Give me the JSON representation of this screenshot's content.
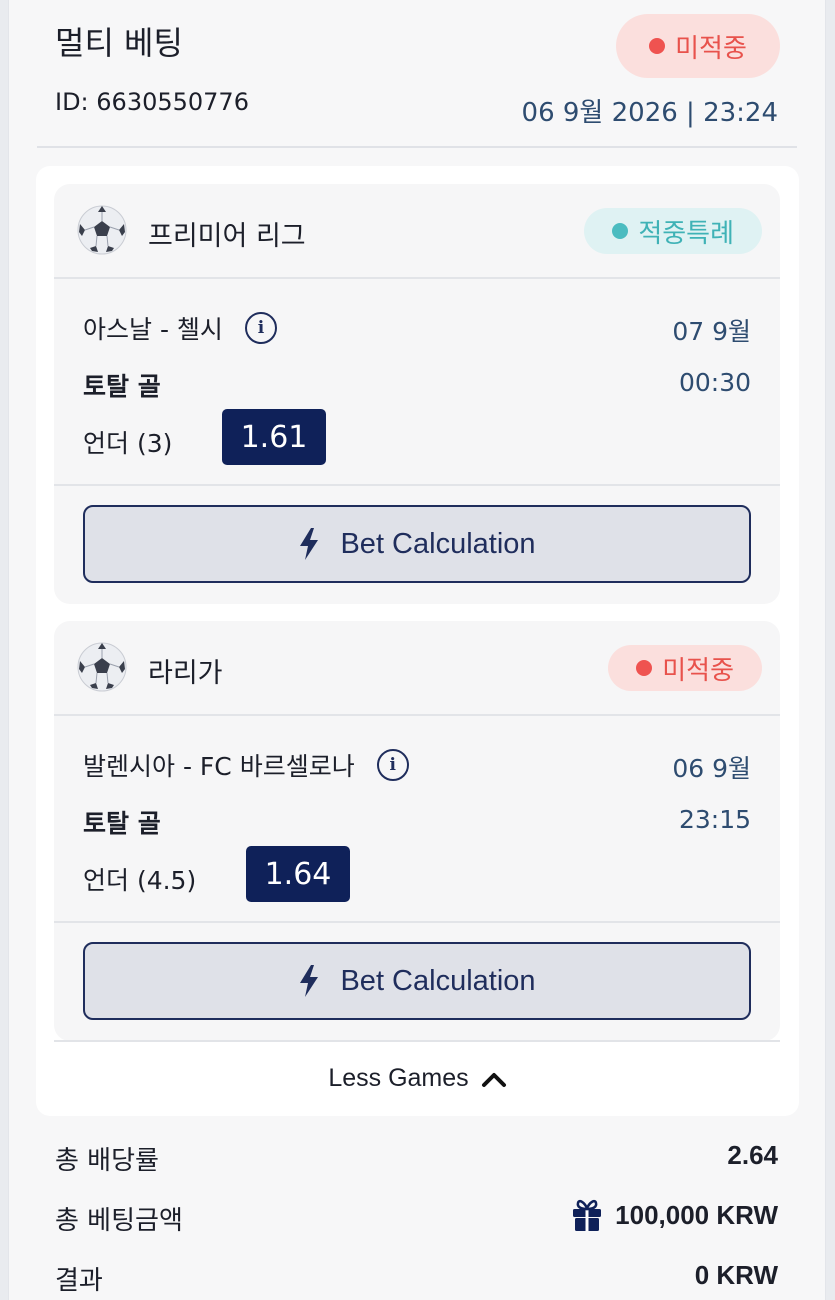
{
  "header": {
    "title": "멀티 베팅",
    "id_text": "ID: 6630550776",
    "status": "미적중",
    "datetime": "06 9월 2026 | 23:24"
  },
  "games": [
    {
      "league": "프리미어 리그",
      "status": "적중특례",
      "match": "아스날 - 첼시",
      "date": "07 9월",
      "market": "토탈 골",
      "time": "00:30",
      "selection": "언더 (3)",
      "odds": "1.61",
      "calc_label": "Bet Calculation"
    },
    {
      "league": "라리가",
      "status": "미적중",
      "match": "발렌시아 - FC 바르셀로나",
      "date": "06 9월",
      "market": "토탈 골",
      "time": "23:15",
      "selection": "언더 (4.5)",
      "odds": "1.64",
      "calc_label": "Bet Calculation"
    }
  ],
  "less_games_label": "Less Games",
  "summary": {
    "total_odds_label": "총 배당률",
    "total_odds_value": "2.64",
    "total_stake_label": "총 베팅금액",
    "total_stake_value": "100,000 KRW",
    "result_label": "결과",
    "result_value": "0 KRW"
  },
  "icons": {
    "sport": "soccer-ball-icon",
    "info": "info-icon",
    "calc": "lightning-bolt-icon",
    "less": "chevron-up-icon",
    "bonus": "gift-icon"
  },
  "colors": {
    "lost": "#ef5350",
    "won_special": "#4bbcc0",
    "primary": "#0f2159",
    "date_text": "#2e4c70"
  }
}
